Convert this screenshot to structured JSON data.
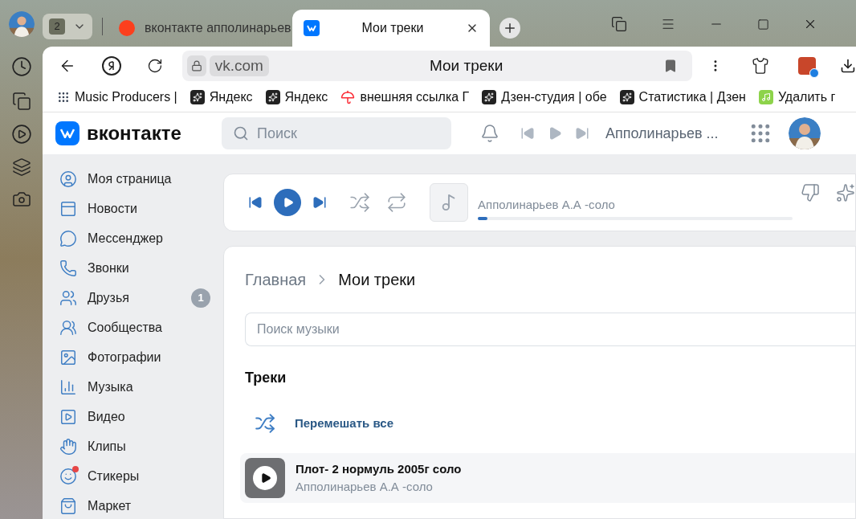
{
  "tab_group": {
    "count": "2"
  },
  "tabs": [
    {
      "title": "вконтакте апполинарьев",
      "selected": false,
      "kind": "yandex"
    },
    {
      "title": "Мои треки",
      "selected": true,
      "kind": "vk"
    }
  ],
  "address": {
    "domain": "vk.com",
    "title": "Мои треки"
  },
  "bookmarks": [
    {
      "label": "Music Producers |",
      "kind": "dots"
    },
    {
      "label": "Яндекс",
      "kind": "star"
    },
    {
      "label": "Яндекс",
      "kind": "star"
    },
    {
      "label": "внешняя ссылка Г",
      "kind": "umbrella"
    },
    {
      "label": "Дзен-студия | обе",
      "kind": "star"
    },
    {
      "label": "Статистика | Дзен",
      "kind": "star"
    },
    {
      "label": "Удалить г",
      "kind": "note"
    }
  ],
  "header": {
    "logo": "вконтакте",
    "search_placeholder": "Поиск",
    "now_playing": "Апполинарьев ..."
  },
  "menu": [
    {
      "label": "Моя страница",
      "kind": "profile"
    },
    {
      "label": "Новости",
      "kind": "news"
    },
    {
      "label": "Мессенджер",
      "kind": "messenger"
    },
    {
      "label": "Звонки",
      "kind": "calls"
    },
    {
      "label": "Друзья",
      "kind": "friends",
      "badge": "1"
    },
    {
      "label": "Сообщества",
      "kind": "communities"
    },
    {
      "label": "Фотографии",
      "kind": "photos"
    },
    {
      "label": "Музыка",
      "kind": "music"
    },
    {
      "label": "Видео",
      "kind": "video"
    },
    {
      "label": "Клипы",
      "kind": "clips"
    },
    {
      "label": "Стикеры",
      "kind": "stickers",
      "dot": true
    },
    {
      "label": "Маркет",
      "kind": "market"
    }
  ],
  "player": {
    "track": "Апполинарьев А.А -соло",
    "level": 0.03
  },
  "breadcrumbs": [
    {
      "label": "Главная",
      "selected": false
    },
    {
      "label": "Мои треки",
      "selected": true
    }
  ],
  "music_search": {
    "placeholder": "Поиск музыки"
  },
  "section_title": "Треки",
  "shuffle_label": "Перемешать все",
  "tracks": [
    {
      "title": "Плот- 2 нормуль 2005г соло",
      "artist": "Апполинарьев А.А -соло"
    }
  ]
}
